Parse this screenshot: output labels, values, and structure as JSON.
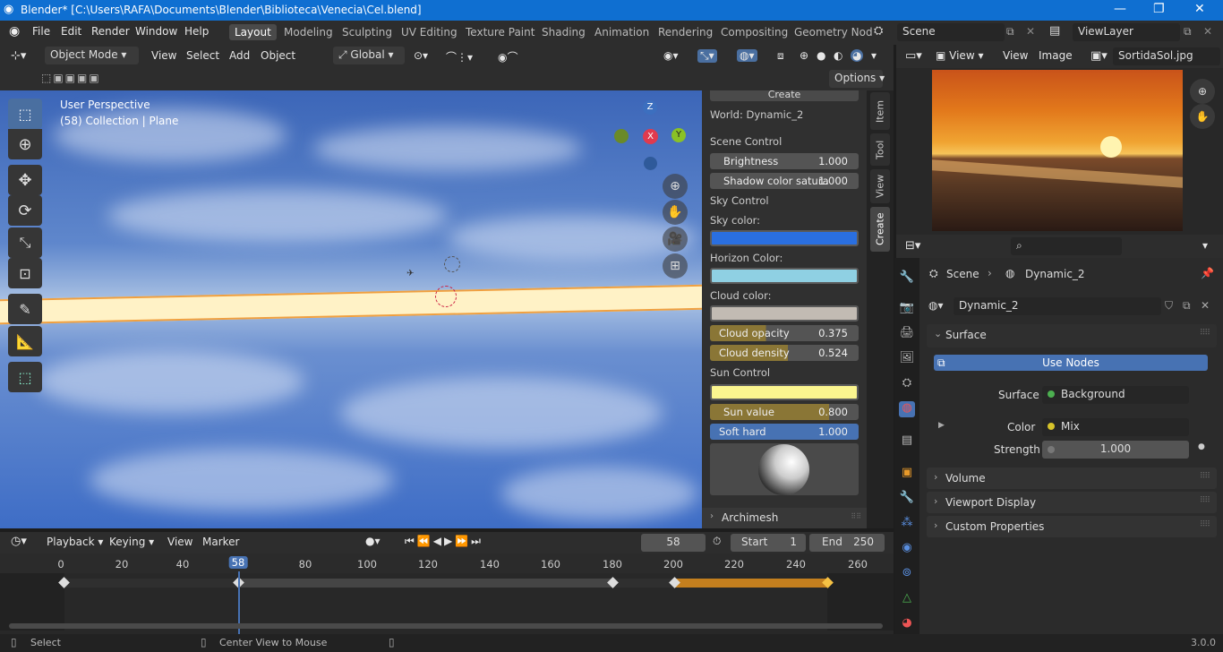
{
  "app": {
    "title": "Blender* [C:\\Users\\RAFA\\Documents\\Blender\\Biblioteca\\Venecia\\Cel.blend]",
    "version": "3.0.0"
  },
  "menu": [
    "File",
    "Edit",
    "Render",
    "Window",
    "Help"
  ],
  "workspaces": [
    "Layout",
    "Modeling",
    "Sculpting",
    "UV Editing",
    "Texture Paint",
    "Shading",
    "Animation",
    "Rendering",
    "Compositing",
    "Geometry Nod"
  ],
  "scene": {
    "name": "Scene",
    "view_layer": "ViewLayer"
  },
  "viewport": {
    "mode": "Object Mode",
    "menus": [
      "View",
      "Select",
      "Add",
      "Object"
    ],
    "orientation": "Global",
    "options_label": "Options",
    "overlay_title": "User Perspective",
    "overlay_subtitle": "(58) Collection | Plane",
    "gizmo": {
      "z": "Z",
      "x": "X",
      "y": "Y"
    }
  },
  "npanel": {
    "create_label": "Create",
    "world": "World: Dynamic_2",
    "scene_control": "Scene Control",
    "brightness": {
      "label": "Brightness",
      "value": "1.000"
    },
    "shadow": {
      "label": "Shadow color satura",
      "value": "1.000"
    },
    "sky_control": "Sky Control",
    "sky_color_label": "Sky color:",
    "sky_color": "#2a6fe0",
    "horizon_color_label": "Horizon Color:",
    "horizon_color": "#8fd0e3",
    "cloud_color_label": "Cloud color:",
    "cloud_color": "#c2bbb3",
    "cloud_opacity": {
      "label": "Cloud opacity",
      "value": "0.375"
    },
    "cloud_density": {
      "label": "Cloud density",
      "value": "0.524"
    },
    "sun_control": "Sun Control",
    "sun_color": "#fbf58f",
    "sun_value": {
      "label": "Sun value",
      "value": "0.800"
    },
    "soft_hard": {
      "label": "Soft hard",
      "value": "1.000"
    },
    "archimesh": "Archimesh",
    "tabs": [
      "Item",
      "Tool",
      "View",
      "Create"
    ]
  },
  "timeline": {
    "menus": [
      "Playback",
      "Keying",
      "View",
      "Marker"
    ],
    "current_frame": "58",
    "start_label": "Start",
    "start": "1",
    "end_label": "End",
    "end": "250",
    "ruler": [
      "0",
      "20",
      "40",
      "58",
      "80",
      "100",
      "120",
      "140",
      "160",
      "180",
      "200",
      "220",
      "240",
      "260"
    ]
  },
  "status": {
    "select": "Select",
    "center": "Center View to Mouse"
  },
  "image_editor": {
    "menus": [
      "View",
      "View",
      "Image"
    ],
    "image_name": "SortidaSol.jpg"
  },
  "properties": {
    "breadcrumb": [
      "Scene",
      "Dynamic_2"
    ],
    "world_name": "Dynamic_2",
    "surface_section": "Surface",
    "use_nodes": "Use Nodes",
    "surface_label": "Surface",
    "surface_value": "Background",
    "color_label": "Color",
    "color_value": "Mix",
    "strength_label": "Strength",
    "strength_value": "1.000",
    "sections": [
      "Volume",
      "Viewport Display",
      "Custom Properties"
    ]
  }
}
